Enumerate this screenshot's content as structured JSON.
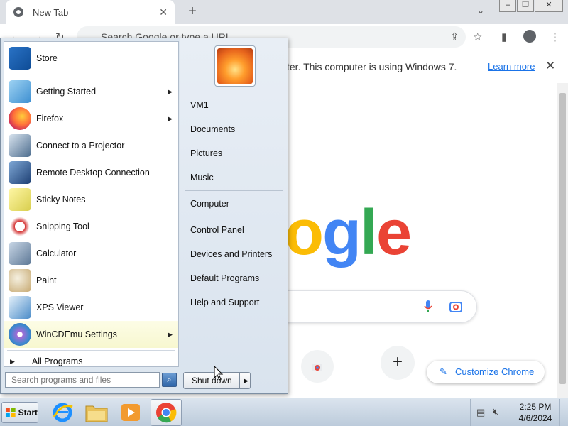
{
  "browser": {
    "tab_title": "New Tab",
    "tab_close": "✕",
    "new_tab": "+",
    "omnibox_placeholder": "Search Google or type a URL",
    "infobar_message": "ter. This computer is using Windows 7.",
    "infobar_link": "Learn more",
    "infobar_close": "✕",
    "shortcut_add": "+",
    "customize_label": "Customize Chrome"
  },
  "start_menu": {
    "programs": [
      {
        "label": "Store",
        "icon": "store-icon",
        "submenu": false
      },
      {
        "label": "Getting Started",
        "icon": "getting-started-icon",
        "submenu": true
      },
      {
        "label": "Firefox",
        "icon": "firefox-icon",
        "submenu": true
      },
      {
        "label": "Connect to a Projector",
        "icon": "projector-icon",
        "submenu": false
      },
      {
        "label": "Remote Desktop Connection",
        "icon": "remote-desktop-icon",
        "submenu": false
      },
      {
        "label": "Sticky Notes",
        "icon": "sticky-notes-icon",
        "submenu": false
      },
      {
        "label": "Snipping Tool",
        "icon": "snipping-tool-icon",
        "submenu": false
      },
      {
        "label": "Calculator",
        "icon": "calculator-icon",
        "submenu": false
      },
      {
        "label": "Paint",
        "icon": "paint-icon",
        "submenu": false
      },
      {
        "label": "XPS Viewer",
        "icon": "xps-viewer-icon",
        "submenu": false
      },
      {
        "label": "WinCDEmu Settings",
        "icon": "wincdemu-icon",
        "submenu": true
      }
    ],
    "all_programs": "All Programs",
    "search_placeholder": "Search programs and files",
    "right_items": [
      "VM1",
      "Documents",
      "Pictures",
      "Music",
      "Computer",
      "Control Panel",
      "Devices and Printers",
      "Default Programs",
      "Help and Support"
    ],
    "shutdown_label": "Shut down"
  },
  "taskbar": {
    "start_label": "Start",
    "time": "2:25 PM",
    "date": "4/6/2024"
  },
  "colors": {
    "chrome_blue": "#1a73e8",
    "google_blue": "#4285f4",
    "google_red": "#ea4335",
    "google_yellow": "#fbbc05",
    "google_green": "#34a853"
  }
}
